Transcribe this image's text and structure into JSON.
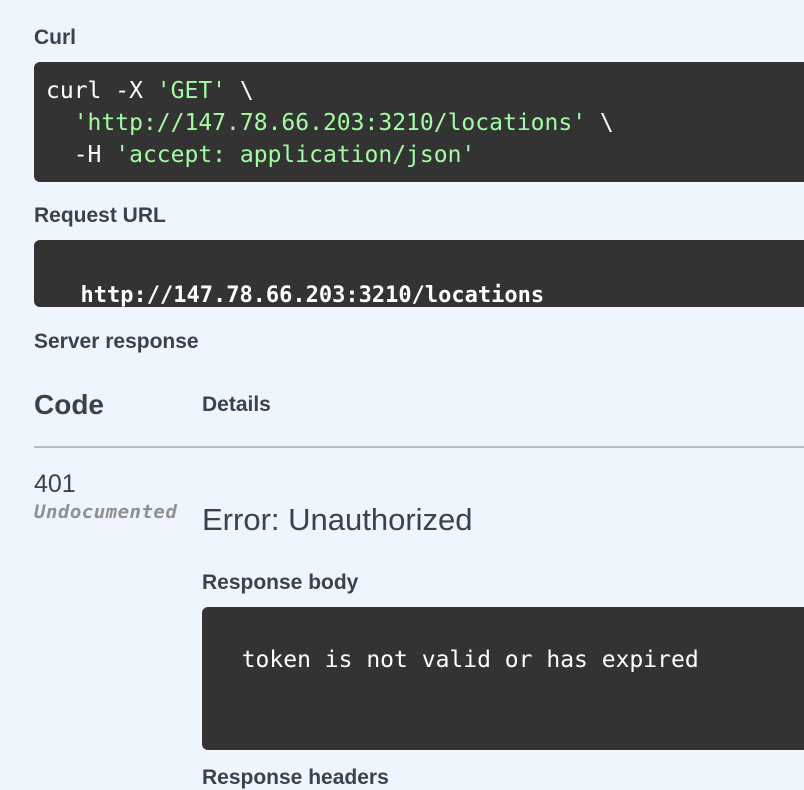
{
  "curl": {
    "label": "Curl",
    "line1_cmd": "curl -X ",
    "line1_method": "'GET'",
    "line1_tail": " \\",
    "line2_indent": "  ",
    "line2_url": "'http://147.78.66.203:3210/locations'",
    "line2_tail": " \\",
    "line3_flag": "  -H ",
    "line3_header": "'accept: application/json'"
  },
  "request_url": {
    "label": "Request URL",
    "value": "http://147.78.66.203:3210/locations"
  },
  "server_response": {
    "label": "Server response",
    "code_header": "Code",
    "details_header": "Details",
    "status_code": "401",
    "status_note": "Undocumented",
    "error_title": "Error: Unauthorized",
    "body_label": "Response body",
    "body_text": "token is not valid or has expired",
    "next_label": "Response headers"
  },
  "colors": {
    "page_bg": "#eef5fd",
    "code_bg": "#333333",
    "string_green": "#a2fca2",
    "text": "#3b4151"
  }
}
